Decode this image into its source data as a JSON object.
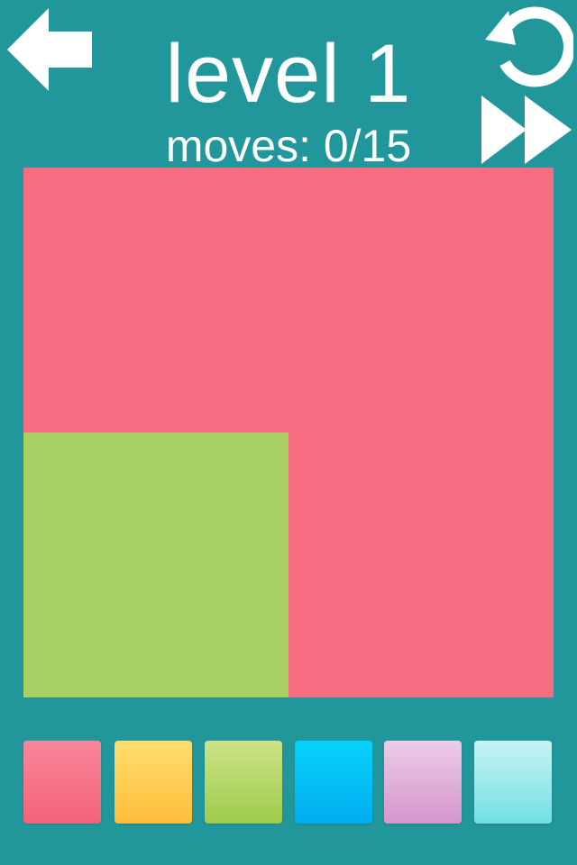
{
  "header": {
    "title": "level 1",
    "moves_label": "moves: 0/15",
    "back_icon": "back-arrow-icon",
    "restart_icon": "restart-icon",
    "skip_icon": "fast-forward-icon"
  },
  "board": {
    "background_color": "#f66c80",
    "grid": "2x2",
    "regions": [
      {
        "name": "pink",
        "color": "#f66c80"
      },
      {
        "name": "green",
        "color": "#a8d062"
      }
    ]
  },
  "palette": {
    "swatches": [
      {
        "name": "pink",
        "top": "#f9879a",
        "bottom": "#f36379"
      },
      {
        "name": "yellow",
        "top": "#ffdd6e",
        "bottom": "#ffbd3a"
      },
      {
        "name": "green",
        "top": "#cde388",
        "bottom": "#9ecb4c"
      },
      {
        "name": "blue",
        "top": "#06d2fb",
        "bottom": "#03acf0"
      },
      {
        "name": "lavender",
        "top": "#eccce6",
        "bottom": "#d596cc"
      },
      {
        "name": "aqua",
        "top": "#c9f3f3",
        "bottom": "#72dfe6"
      }
    ]
  },
  "colors": {
    "background": "#21979c",
    "text": "#ffffff"
  }
}
